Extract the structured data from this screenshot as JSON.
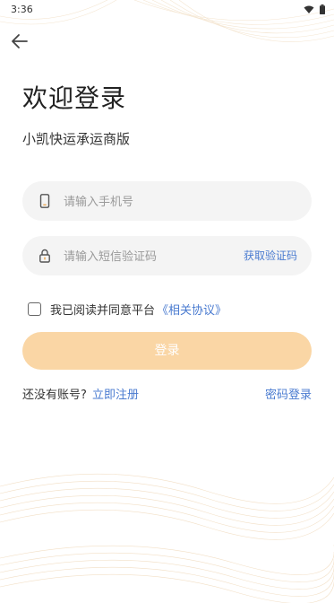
{
  "status_bar": {
    "time": "3:36",
    "icons": [
      "wifi-icon",
      "battery-icon"
    ]
  },
  "header": {
    "back_icon": "arrow-left-icon"
  },
  "title": "欢迎登录",
  "subtitle": "小凯快运承运商版",
  "form": {
    "phone": {
      "placeholder": "请输入手机号",
      "value": "",
      "icon": "phone-icon"
    },
    "code": {
      "placeholder": "请输入短信验证码",
      "value": "",
      "icon": "lock-icon",
      "get_code_label": "获取验证码"
    }
  },
  "agreement": {
    "checked": false,
    "text": "我已阅读并同意平台",
    "link": "《相关协议》"
  },
  "login_button": "登录",
  "footer": {
    "no_account_text": "还没有账号?",
    "register_link": "立即注册",
    "password_login_link": "密码登录"
  },
  "colors": {
    "accent_link": "#4a7bd0",
    "login_button_bg": "#fad6a5",
    "field_bg": "#f4f4f4"
  }
}
